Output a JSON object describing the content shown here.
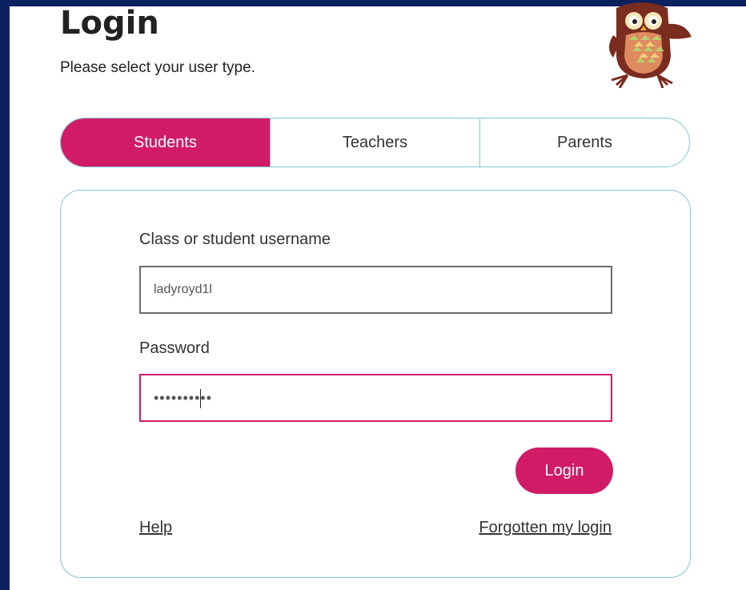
{
  "page": {
    "title": "Login",
    "subtitle": "Please select your user type."
  },
  "user_types": {
    "active_index": 0,
    "tabs": [
      {
        "label": "Students"
      },
      {
        "label": "Teachers"
      },
      {
        "label": "Parents"
      }
    ]
  },
  "form": {
    "username_label": "Class or student username",
    "username_value": "ladyroyd1l",
    "password_label": "Password",
    "password_value": "••••••••••",
    "login_label": "Login",
    "help_link": "Help",
    "forgot_link": "Forgotten my login"
  },
  "colors": {
    "background": "#0b2160",
    "accent": "#d11b67",
    "border": "#7fc6d6"
  },
  "icons": {
    "mascot": "owl-mascot-icon"
  }
}
